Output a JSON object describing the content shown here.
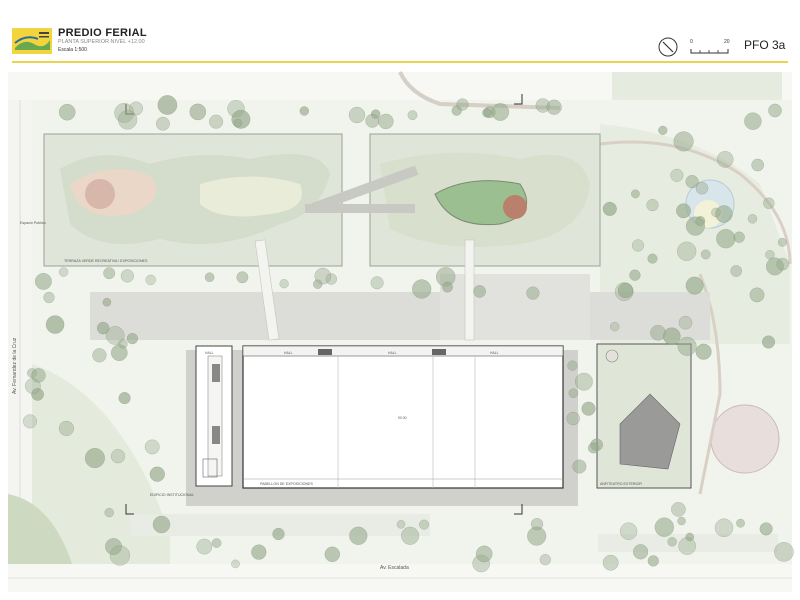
{
  "header": {
    "logo_icon": "predio-ferial-logo",
    "title": "PREDIO FERIAL",
    "subtitle": "PLANTA SUPERIOR NIVEL +12.00",
    "scale_label": "Escala 1:500",
    "scalebar_start": "0",
    "scalebar_end": "20",
    "sheet_code": "PFO 3a",
    "accent_color": "#e8d44d"
  },
  "plan": {
    "streets": {
      "left_avenue": "Av. Fernandez de la Cruz",
      "bottom_avenue": "Av. Escalada"
    },
    "roof_terrace_label": "TERRAZA VERDE RECREATIVA / EXPOSICIONES",
    "left_small_label": "Espacio Publico",
    "buildings": {
      "institutional": "EDIFICIO INSTITUCIONAL",
      "exhibition_pavilion": "PABELLON DE EXPOSICIONES",
      "amphitheater": "ANFITEATRO EXTERIOR"
    },
    "hall_labels": [
      "HALL",
      "HALL",
      "HALL",
      "HALL"
    ],
    "dimension_label": "90.00",
    "colors": {
      "roof": "#dfe4d8",
      "park": "#e9eee4",
      "trees": "#b4c2a8",
      "pavilion": "#ffffff",
      "plaza": "#d9d9d6"
    }
  }
}
